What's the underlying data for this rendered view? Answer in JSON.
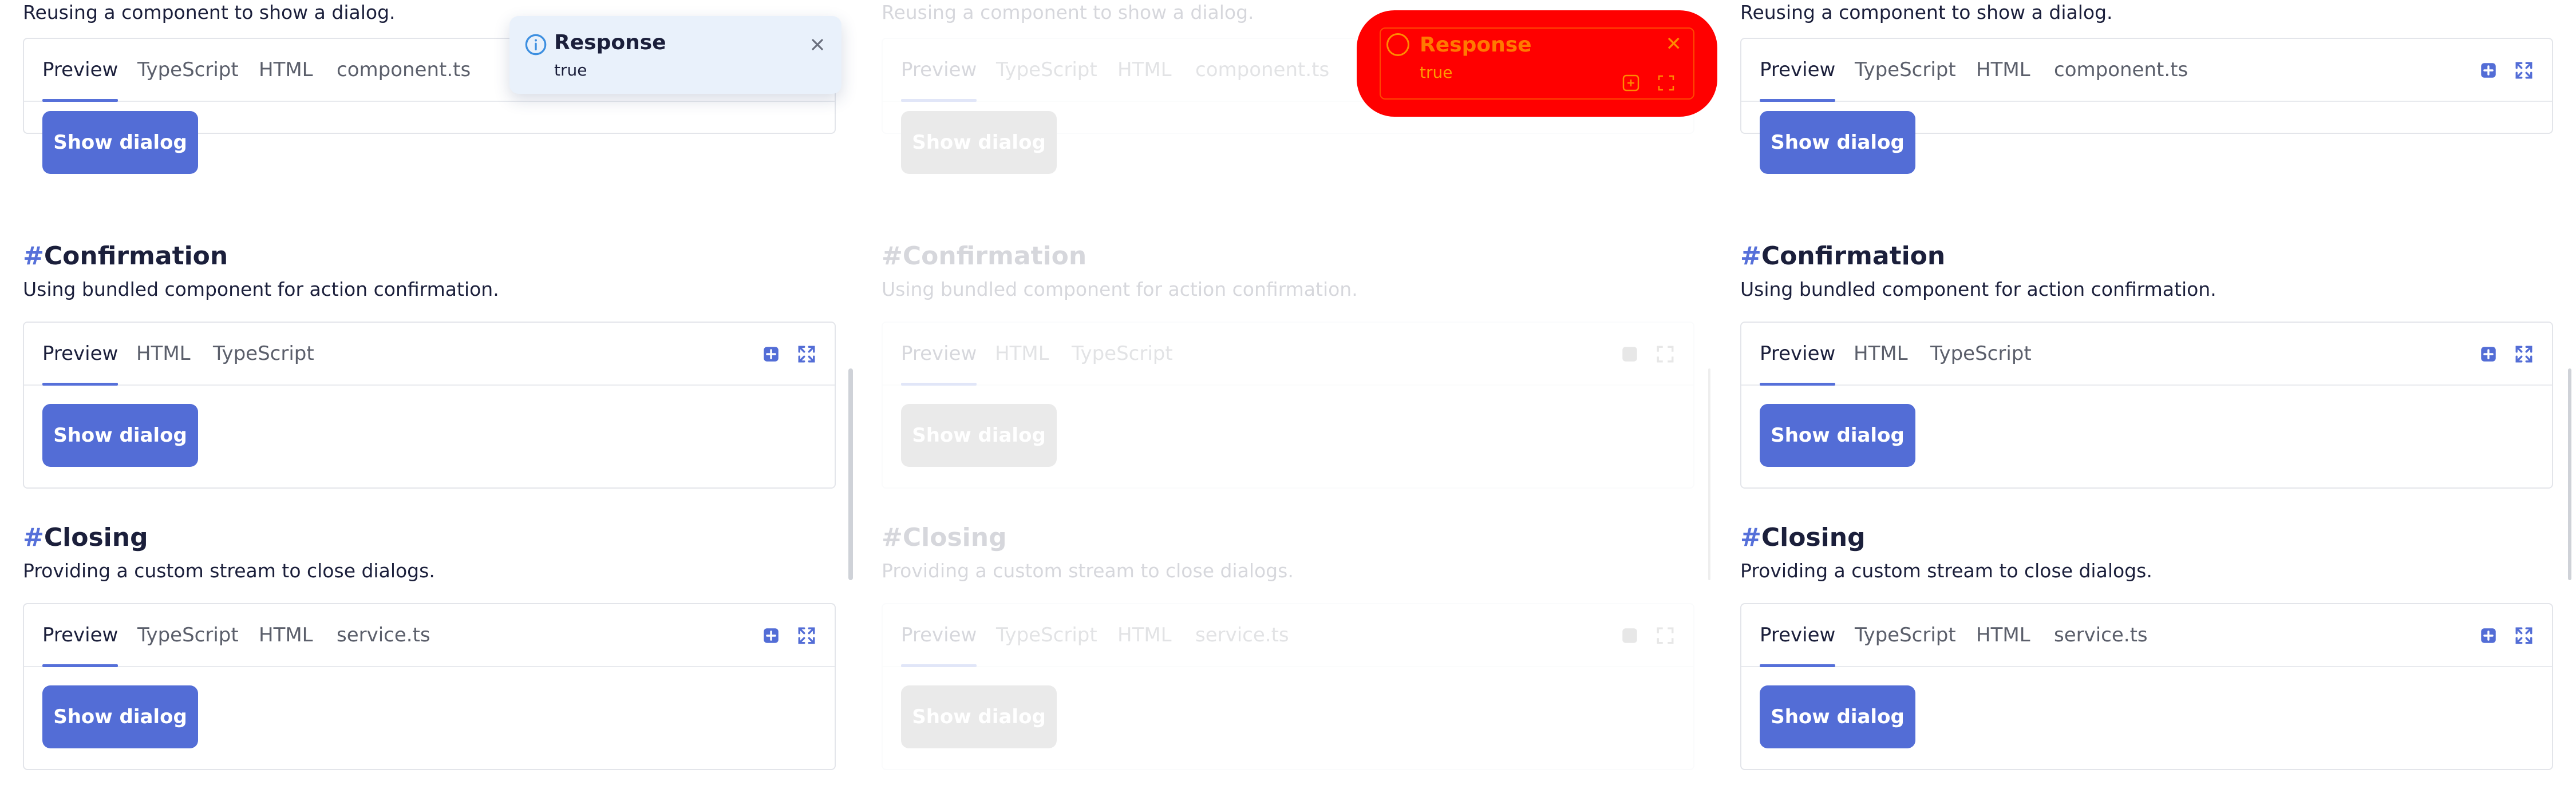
{
  "toast": {
    "title": "Response",
    "message": "true"
  },
  "sections": [
    {
      "id": "reuse",
      "heading": "",
      "description": "Reusing a component to show a dialog.",
      "tabs": [
        "Preview",
        "TypeScript",
        "HTML",
        "component.ts"
      ],
      "button": "Show dialog"
    },
    {
      "id": "confirmation",
      "hash": "#",
      "heading": "Confirmation",
      "description": "Using bundled component for action confirmation.",
      "tabs": [
        "Preview",
        "HTML",
        "TypeScript"
      ],
      "button": "Show dialog"
    },
    {
      "id": "closing",
      "hash": "#",
      "heading": "Closing",
      "description": "Providing a custom stream to close dialogs.",
      "tabs": [
        "Preview",
        "TypeScript",
        "HTML",
        "service.ts"
      ],
      "button": "Show dialog"
    }
  ],
  "icons": {
    "toolbar": [
      "open-in-new-icon",
      "fullscreen-icon"
    ],
    "toast": [
      "info-icon",
      "close-icon"
    ]
  },
  "colors": {
    "accent": "#536dd6",
    "toast_bg": "#e9f1fb",
    "highlight": "#ff0000"
  }
}
